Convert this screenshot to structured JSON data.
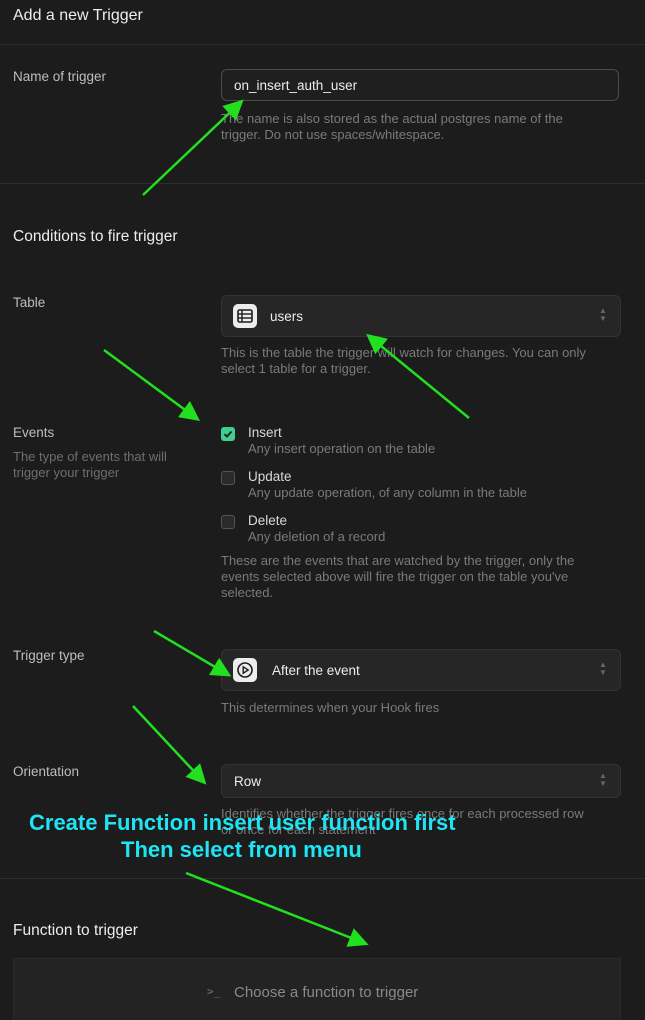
{
  "header": {
    "title": "Add a new Trigger"
  },
  "name_field": {
    "label": "Name of trigger",
    "value": "on_insert_auth_user",
    "help_line1": "The name is also stored as the actual postgres name of the",
    "help_line2": "trigger. Do not use spaces/whitespace."
  },
  "conditions": {
    "title": "Conditions to fire trigger"
  },
  "table_field": {
    "label": "Table",
    "value": "users",
    "help_line1": "This is the table the trigger will watch for changes. You can only",
    "help_line2": "select 1 table for a trigger."
  },
  "events": {
    "label": "Events",
    "desc_line1": "The type of events that will",
    "desc_line2": "trigger your trigger",
    "items": [
      {
        "title": "Insert",
        "desc": "Any insert operation on the table",
        "checked": true
      },
      {
        "title": "Update",
        "desc": "Any update operation, of any column in the table",
        "checked": false
      },
      {
        "title": "Delete",
        "desc": "Any deletion of a record",
        "checked": false
      }
    ],
    "help_line1": "These are the events that are watched by the trigger, only the",
    "help_line2": "events selected above will fire the trigger on the table you've",
    "help_line3": "selected."
  },
  "trigger_type": {
    "label": "Trigger type",
    "value": "After the event",
    "help": "This determines when your Hook fires"
  },
  "orientation": {
    "label": "Orientation",
    "value": "Row",
    "help_line1": "Identifies whether the trigger fires once for each processed row",
    "help_line2": "or once for each statement"
  },
  "annotation": {
    "line1": "Create Function insert user function first",
    "line2": "Then select from menu"
  },
  "function_section": {
    "title": "Function to trigger",
    "placeholder": "Choose a function to trigger",
    "prompt_glyph": ">_"
  },
  "colors": {
    "accent_green": "#3ecf8e",
    "arrow_green": "#22e01f",
    "annotation_cyan": "#1ee4f3"
  }
}
